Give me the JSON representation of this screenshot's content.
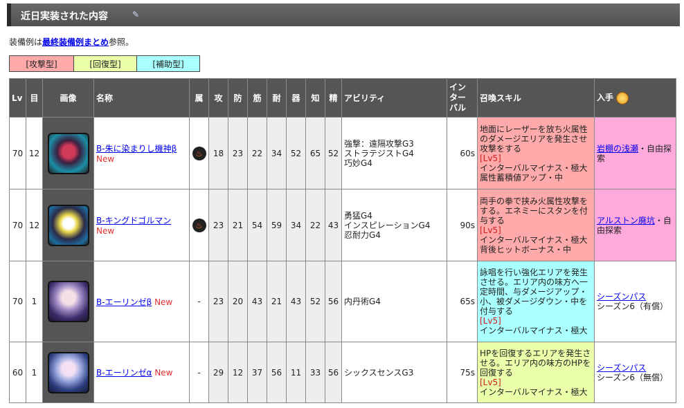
{
  "header": {
    "title": "近日実装された内容",
    "edit_icon": "pencil-icon"
  },
  "intro": {
    "prefix": "装備例は",
    "link": "最終装備例まとめ",
    "suffix": "参照。"
  },
  "legend": {
    "attack": "[攻撃型]",
    "recovery": "[回復型]",
    "support": "[補助型]"
  },
  "colors": {
    "attack": "#ffaaaa",
    "recovery": "#eaffaa",
    "support": "#aaffff",
    "source_pink": "#ffaadd",
    "new": "#e03030"
  },
  "columns": {
    "lv": "Lv",
    "mokume": "目",
    "image": "画像",
    "name": "名称",
    "attr": "属",
    "atk": "攻",
    "def": "防",
    "str": "筋",
    "end": "耐",
    "dex": "器",
    "int": "知",
    "spi": "精",
    "ability": "アビリティ",
    "interval": [
      "イン",
      "ター",
      "バル"
    ],
    "skill": "召喚スキル",
    "source": "入手"
  },
  "rows": [
    {
      "lv": "70",
      "mokume": "12",
      "name": "B-朱に染まりし機神β",
      "new": "New",
      "attr": "fire-icon",
      "stats": [
        "18",
        "23",
        "22",
        "34",
        "52",
        "65",
        "52"
      ],
      "abilities": [
        "強撃：遠隔攻撃G3",
        "ストラテジストG4",
        "巧妙G4"
      ],
      "interval": "60s",
      "skill": {
        "desc": "地面にレーザーを放ち火属性のダメージエリアを発生させ攻撃をする",
        "lv": "[Lv5]",
        "effects": [
          "インターバルマイナス・極大",
          "属性蓄積値アップ・中"
        ]
      },
      "source": {
        "link": "岩棚の浅瀬",
        "rest": "・自由探索"
      }
    },
    {
      "lv": "70",
      "mokume": "12",
      "name": "B-キングドゴルマン",
      "new": "New",
      "attr": "fire-icon",
      "stats": [
        "23",
        "21",
        "54",
        "59",
        "34",
        "22",
        "43"
      ],
      "abilities": [
        "勇猛G4",
        "インスピレーションG4",
        "忍耐力G4"
      ],
      "interval": "90s",
      "skill": {
        "desc": "両手の拳で挟み火属性攻撃をする。エネミーにスタンを付与する",
        "lv": "[Lv5]",
        "effects": [
          "インターバルマイナス・極大",
          "背後ヒットボーナス・中"
        ]
      },
      "source": {
        "link": "アルストン廃坑",
        "rest": "・自由探索"
      }
    },
    {
      "lv": "70",
      "mokume": "1",
      "name": "B-エーリンゼβ",
      "new": "New",
      "attr": "-",
      "stats": [
        "23",
        "20",
        "43",
        "21",
        "43",
        "52",
        "56"
      ],
      "abilities": [
        "内丹術G4"
      ],
      "interval": "65s",
      "skill": {
        "desc": "詠唱を行い強化エリアを発生させる。エリア内の味方へ一定時間、与ダメージアップ・小、被ダメージダウン・中を付与する",
        "lv": "[Lv5]",
        "effects": [
          "インターバルマイナス・極大"
        ]
      },
      "source": {
        "link": "シーズンパス",
        "rest": "シーズン6（有償）"
      }
    },
    {
      "lv": "60",
      "mokume": "1",
      "name": "B-エーリンゼα",
      "new": "New",
      "attr": "-",
      "stats": [
        "29",
        "12",
        "37",
        "56",
        "11",
        "33",
        "56"
      ],
      "abilities": [
        "シックスセンスG3"
      ],
      "interval": "75s",
      "skill": {
        "desc": "HPを回復するエリアを発生させる。エリア内の味方のHPを回復する",
        "lv": "[Lv5]",
        "effects": [
          "インターバルマイナス・極大"
        ]
      },
      "source": {
        "link": "シーズンパス",
        "rest": "シーズン6（無償）"
      }
    }
  ]
}
